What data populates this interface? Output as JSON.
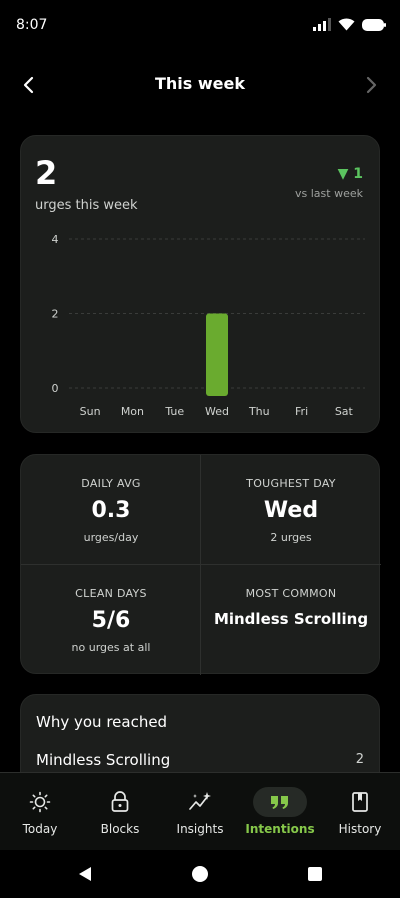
{
  "status": {
    "time": "8:07"
  },
  "header": {
    "title": "This week"
  },
  "summary": {
    "count": "2",
    "count_label": "urges this week",
    "delta": "▼ 1",
    "delta_label": "vs last week"
  },
  "chart_data": {
    "type": "bar",
    "categories": [
      "Sun",
      "Mon",
      "Tue",
      "Wed",
      "Thu",
      "Fri",
      "Sat"
    ],
    "values": [
      0,
      0,
      0,
      2,
      0,
      0,
      0
    ],
    "yticks": [
      "0",
      "2",
      "4"
    ],
    "ylim": [
      0,
      4
    ],
    "grid": true,
    "bar_color": "#6aab2f"
  },
  "stats": {
    "daily_avg": {
      "label": "DAILY AVG",
      "value": "0.3",
      "sub": "urges/day"
    },
    "toughest_day": {
      "label": "TOUGHEST DAY",
      "value": "Wed",
      "sub": "2 urges"
    },
    "clean_days": {
      "label": "CLEAN DAYS",
      "value": "5/6",
      "sub": "no urges at all"
    },
    "most_common": {
      "label": "MOST COMMON",
      "value": "Mindless Scrolling"
    }
  },
  "why": {
    "title": "Why you reached",
    "items": [
      {
        "label": "Mindless Scrolling",
        "count": "2"
      }
    ]
  },
  "tabs": [
    {
      "label": "Today",
      "icon": "sun-icon",
      "active": false
    },
    {
      "label": "Blocks",
      "icon": "lock-icon",
      "active": false
    },
    {
      "label": "Insights",
      "icon": "sparkle-chart-icon",
      "active": false
    },
    {
      "label": "Intentions",
      "icon": "quote-icon",
      "active": true
    },
    {
      "label": "History",
      "icon": "book-icon",
      "active": false
    }
  ],
  "colors": {
    "accent": "#86c84a",
    "delta": "#5bc45f",
    "card": "#1c1e1c"
  }
}
